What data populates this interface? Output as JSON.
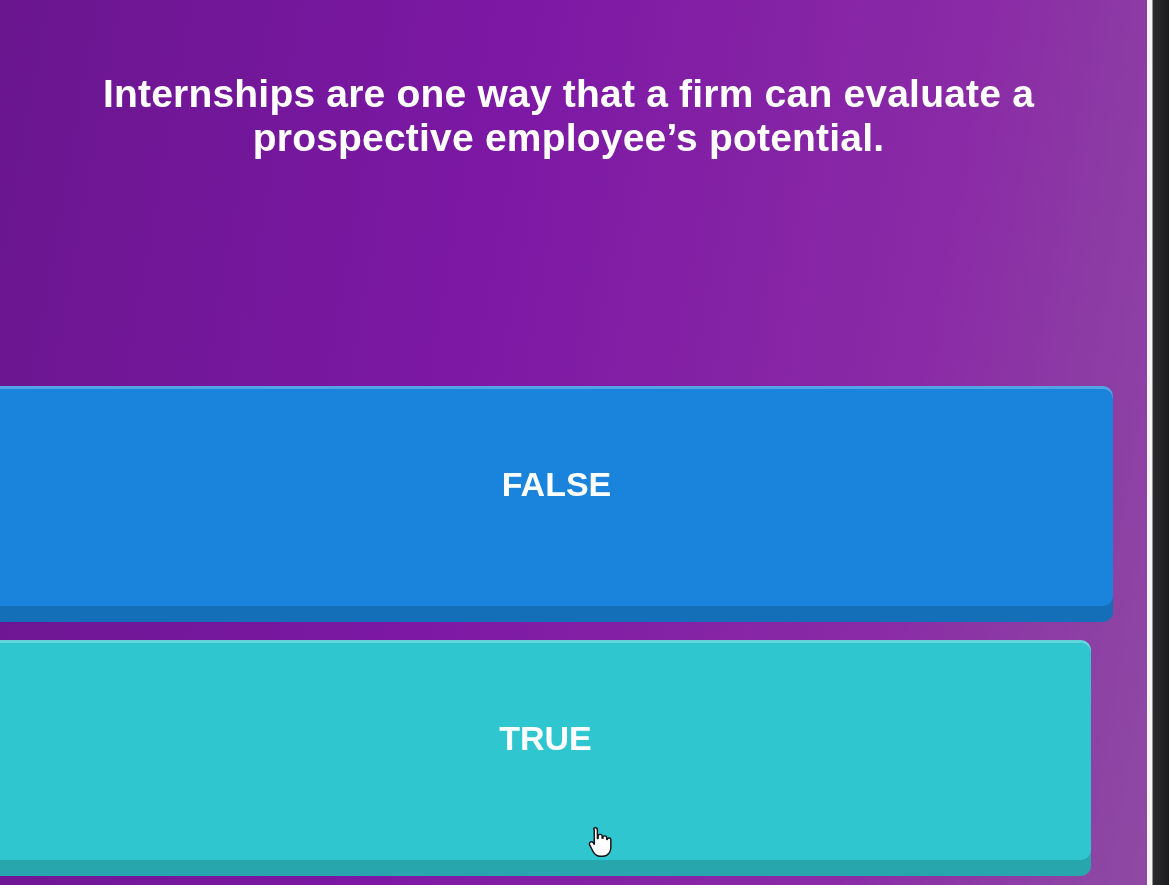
{
  "question": {
    "text": "Internships are one way that a firm can evaluate a prospective employee’s potential."
  },
  "answers": [
    {
      "label": "FALSE",
      "color": "#1a84dc"
    },
    {
      "label": "TRUE",
      "color": "#2fc6cf"
    }
  ]
}
